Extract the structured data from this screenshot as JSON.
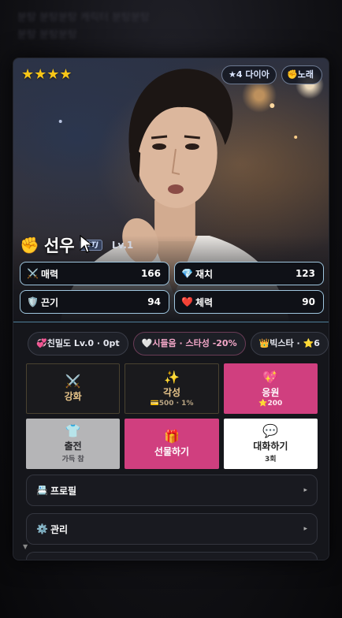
{
  "background_text": [
    "분탕 분탕분탕 캐릭터 분탕분탕",
    "분탕 분탕분탕"
  ],
  "card": {
    "stars": "★★★★",
    "grade": "★4 다이아",
    "type_badge": "✊노래",
    "name_icon": "✊",
    "name": "선우",
    "mbti": "ISTJ",
    "level": "Lv.1"
  },
  "stats": [
    {
      "icon": "⚔️",
      "label": "매력",
      "value": "166",
      "icon_name": "swords-icon"
    },
    {
      "icon": "💎",
      "label": "재치",
      "value": "123",
      "icon_name": "gem-icon"
    },
    {
      "icon": "🛡️",
      "label": "끈기",
      "value": "94",
      "icon_name": "shield-icon"
    },
    {
      "icon": "❤️",
      "label": "체력",
      "value": "90",
      "icon_name": "heart-icon"
    }
  ],
  "tags": [
    {
      "text": "💞친밀도 Lv.0 · 0pt",
      "style": "normal"
    },
    {
      "text": "🤍시들음 · 스타성 -20%",
      "style": "pink"
    },
    {
      "text": "👑빅스타 · ⭐6",
      "style": "normal"
    }
  ],
  "actions": [
    {
      "icon": "⚔️",
      "label": "강화",
      "sub": "",
      "style": "dark",
      "name": "enhance-button"
    },
    {
      "icon": "✨",
      "label": "각성",
      "sub": "💳500 · 1%",
      "style": "dark",
      "name": "awaken-button"
    },
    {
      "icon": "💖",
      "label": "응원",
      "sub": "⭐200",
      "style": "pink",
      "name": "cheer-button"
    },
    {
      "icon": "👕",
      "label": "출전",
      "sub": "가득 참",
      "style": "gray",
      "name": "deploy-button"
    },
    {
      "icon": "🎁",
      "label": "선물하기",
      "sub": "",
      "style": "pink",
      "name": "gift-button"
    },
    {
      "icon": "💬",
      "label": "대화하기",
      "sub": "3회",
      "style": "white",
      "name": "talk-button"
    }
  ],
  "menus": {
    "profile": {
      "icon": "📇",
      "label": "프로필",
      "arrow": "▸"
    },
    "manage": {
      "icon": "⚙️",
      "label": "관리",
      "arrow": "▸"
    }
  },
  "colors": {
    "accent_pink": "#d03f7f",
    "stat_border": "#9fc6df",
    "star": "#f6c518"
  }
}
